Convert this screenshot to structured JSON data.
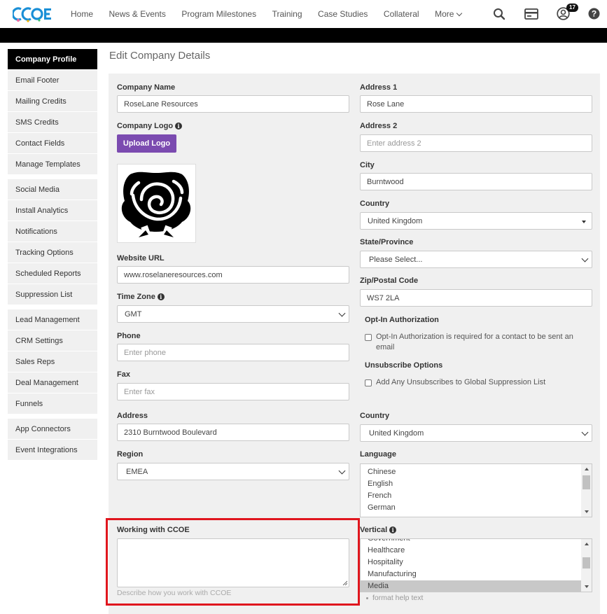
{
  "brand": {
    "logo_text": "CCOE",
    "accent": "#1a8fd6",
    "button_color": "#7b4bb0",
    "highlight_color": "#e0161e"
  },
  "nav": {
    "links": [
      "Home",
      "News & Events",
      "Program Milestones",
      "Training",
      "Case Studies",
      "Collateral",
      "More"
    ],
    "icons": [
      "search-icon",
      "card-icon",
      "user-icon",
      "help-icon"
    ],
    "notification_count": "17"
  },
  "sidebar": {
    "groups": [
      [
        "Company Profile",
        "Email Footer",
        "Mailing Credits",
        "SMS Credits",
        "Contact Fields",
        "Manage Templates"
      ],
      [
        "Social Media",
        "Install Analytics",
        "Notifications",
        "Tracking Options",
        "Scheduled Reports",
        "Suppression List"
      ],
      [
        "Lead Management",
        "CRM Settings",
        "Sales Reps",
        "Deal Management",
        "Funnels"
      ],
      [
        "App Connectors",
        "Event Integrations"
      ]
    ],
    "active": "Company Profile"
  },
  "page": {
    "title": "Edit Company Details"
  },
  "form": {
    "company_name": {
      "label": "Company Name",
      "value": "RoseLane Resources"
    },
    "company_logo": {
      "label": "Company Logo",
      "button": "Upload Logo",
      "logo_icon": "rose-logo-icon"
    },
    "website_url": {
      "label": "Website URL",
      "value": "www.roselaneresources.com"
    },
    "time_zone": {
      "label": "Time Zone",
      "value": "GMT"
    },
    "phone": {
      "label": "Phone",
      "placeholder": "Enter phone"
    },
    "fax": {
      "label": "Fax",
      "placeholder": "Enter fax"
    },
    "address": {
      "label": "Address",
      "value": "2310 Burntwood Boulevard"
    },
    "region": {
      "label": "Region",
      "value": "EMEA"
    },
    "working_with": {
      "label": "Working with CCOE",
      "help": "Describe how you work with CCOE",
      "value": ""
    },
    "address1": {
      "label": "Address 1",
      "value": "Rose Lane"
    },
    "address2": {
      "label": "Address 2",
      "placeholder": "Enter address 2"
    },
    "city": {
      "label": "City",
      "value": "Burntwood"
    },
    "country": {
      "label": "Country",
      "value": "United Kingdom"
    },
    "state": {
      "label": "State/Province",
      "value": "Please Select..."
    },
    "zip": {
      "label": "Zip/Postal Code",
      "value": "WS7 2LA"
    },
    "opt_in": {
      "heading": "Opt-In Authorization",
      "checkbox": "Opt-In Authorization is required for a contact to be sent an email",
      "checked": false
    },
    "unsubscribe": {
      "heading": "Unsubscribe Options",
      "checkbox": "Add Any Unsubscribes to Global Suppression List",
      "checked": false
    },
    "country2": {
      "label": "Country",
      "value": "United Kingdom"
    },
    "language": {
      "label": "Language",
      "options": [
        "Chinese",
        "English",
        "French",
        "German"
      ]
    },
    "vertical": {
      "label": "Vertical",
      "options": [
        "Government",
        "Healthcare",
        "Hospitality",
        "Manufacturing",
        "Media"
      ],
      "selected": "Media",
      "help": "format help text"
    }
  }
}
